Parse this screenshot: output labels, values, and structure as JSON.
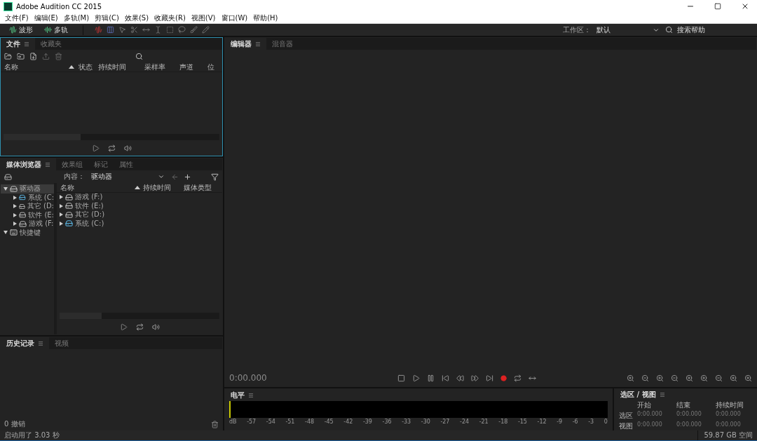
{
  "window": {
    "title": "Adobe Audition CC 2015"
  },
  "menu": [
    "文件(F)",
    "编辑(E)",
    "多轨(M)",
    "剪辑(C)",
    "效果(S)",
    "收藏夹(R)",
    "视图(V)",
    "窗口(W)",
    "帮助(H)"
  ],
  "toolbar": {
    "views": [
      {
        "label": "波形",
        "selected": false
      },
      {
        "label": "多轨",
        "selected": false
      }
    ],
    "workspace_label": "工作区：",
    "workspace_value": "默认",
    "search_help": "搜索帮助"
  },
  "files_panel": {
    "focused": true,
    "tabs": [
      {
        "label": "文件",
        "selected": true
      },
      {
        "label": "收藏夹",
        "selected": false
      }
    ],
    "columns": [
      "名称",
      "状态",
      "持续时间",
      "采样率",
      "声道",
      "位"
    ]
  },
  "media_browser": {
    "tabs": [
      {
        "label": "媒体浏览器",
        "selected": true
      },
      {
        "label": "效果组",
        "selected": false
      },
      {
        "label": "标记",
        "selected": false
      },
      {
        "label": "属性",
        "selected": false
      }
    ],
    "content_label": "内容：",
    "content_value": "驱动器",
    "tree": [
      {
        "label": "驱动器",
        "kind": "drive",
        "expanded": true,
        "selected": true,
        "children": [
          {
            "label": "系统 (C:",
            "kind": "system",
            "expanded": false,
            "selected": false
          },
          {
            "label": "其它 (D:",
            "kind": "drive",
            "expanded": false,
            "selected": false
          },
          {
            "label": "软件 (E:",
            "kind": "drive",
            "expanded": false,
            "selected": false
          },
          {
            "label": "游戏 (F:",
            "kind": "drive",
            "expanded": false,
            "selected": false
          }
        ]
      },
      {
        "label": "快捷键",
        "kind": "shortcut",
        "expanded": true,
        "selected": false
      }
    ],
    "columns": [
      "名称",
      "持续时间",
      "媒体类型"
    ],
    "rows": [
      {
        "name": "游戏 (F:)",
        "kind": "drive"
      },
      {
        "name": "软件 (E:)",
        "kind": "drive"
      },
      {
        "name": "其它 (D:)",
        "kind": "drive"
      },
      {
        "name": "系统 (C:)",
        "kind": "system"
      }
    ]
  },
  "history_panel": {
    "tabs": [
      {
        "label": "历史记录",
        "selected": true
      },
      {
        "label": "视频",
        "selected": false
      }
    ],
    "undo_count": "0 撤销"
  },
  "editor": {
    "tabs": [
      {
        "label": "编辑器",
        "selected": true
      },
      {
        "label": "混音器",
        "selected": false
      }
    ],
    "time": "0:00.000"
  },
  "levels": {
    "title": "电平",
    "scale": [
      "dB",
      "-57",
      "-54",
      "-51",
      "-48",
      "-45",
      "-42",
      "-39",
      "-36",
      "-33",
      "-30",
      "-27",
      "-24",
      "-21",
      "-18",
      "-15",
      "-12",
      "-9",
      "-6",
      "-3",
      "0"
    ]
  },
  "selection_view": {
    "title": "选区 / 视图",
    "columns": [
      "开始",
      "结束",
      "持续时间"
    ],
    "rows": [
      {
        "label": "选区",
        "values": [
          "0:00.000",
          "0:00.000",
          "0:00.000"
        ]
      },
      {
        "label": "视图",
        "values": [
          "0:00.000",
          "0:00.000",
          "0:00.000"
        ]
      }
    ]
  },
  "status_bar": {
    "left": "启动用了 3.03 秒",
    "right": "59.87 GB 空间"
  }
}
